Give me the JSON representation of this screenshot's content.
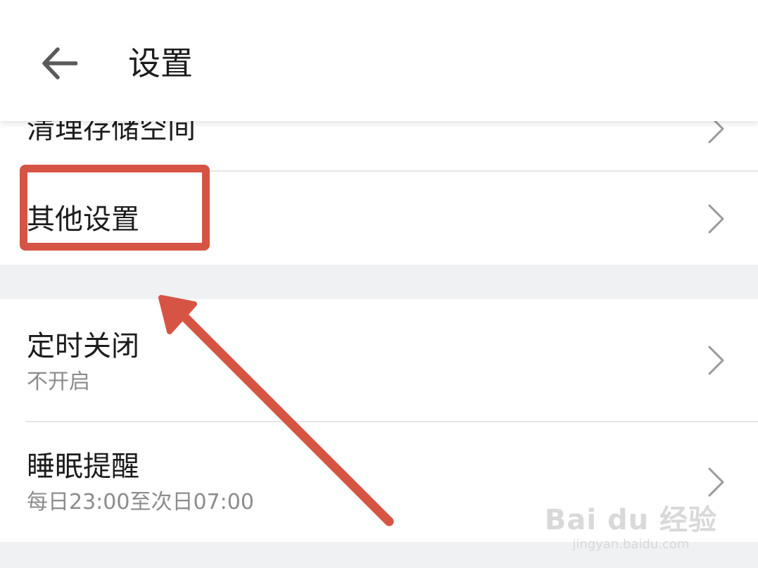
{
  "header": {
    "title": "设置",
    "back_icon": "arrow-left-icon"
  },
  "settings": {
    "clear_storage": {
      "label": "清理存储空间"
    },
    "other_settings": {
      "label": "其他设置"
    },
    "timer_close": {
      "label": "定时关闭",
      "value": "不开启"
    },
    "sleep_reminder": {
      "label": "睡眠提醒",
      "value": "每日23:00至次日07:00"
    }
  },
  "annotation": {
    "color": "#d65444",
    "shapes": [
      "highlight-box",
      "pointer-arrow"
    ]
  },
  "watermark": {
    "logo": "Bai du 经验",
    "url": "jingyan.baidu.com"
  }
}
